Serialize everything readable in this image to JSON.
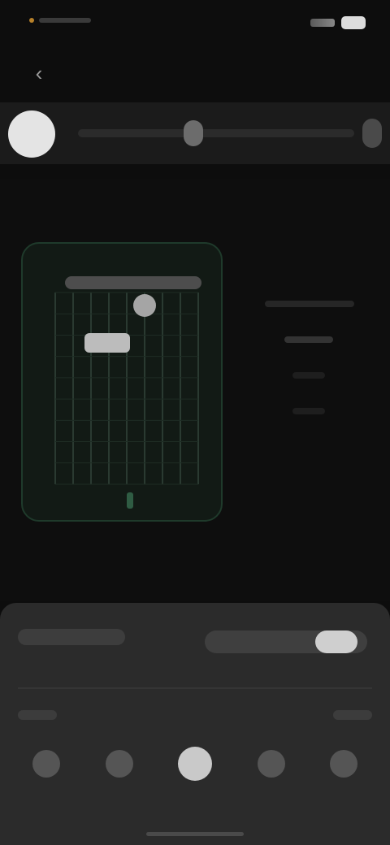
{
  "status_bar": {
    "time": "",
    "icons": [
      "signal-icon",
      "battery-icon"
    ]
  },
  "nav": {
    "back_icon": "chevron-left-icon",
    "back_glyph": "‹"
  },
  "toolbar": {
    "primary_icon": "color-swatch-icon",
    "slider_level": 0.45
  },
  "canvas": {
    "grid_card": {
      "columns": 8,
      "rows": 9,
      "accent": "#1f3a2b",
      "highlight_color": "#bcbcbc"
    }
  },
  "sheet": {
    "title": "",
    "toggle_on": true,
    "left_label": "",
    "right_label": "",
    "options": [
      {
        "glyph": ""
      },
      {
        "glyph": ""
      },
      {
        "glyph": ""
      },
      {
        "glyph": ""
      },
      {
        "glyph": ""
      }
    ],
    "selected_index": 2
  },
  "colors": {
    "background": "#0d0d0d",
    "sheet": "#2b2b2b",
    "accent_green": "#1f3a2b",
    "status_accent": "#b7812a"
  }
}
